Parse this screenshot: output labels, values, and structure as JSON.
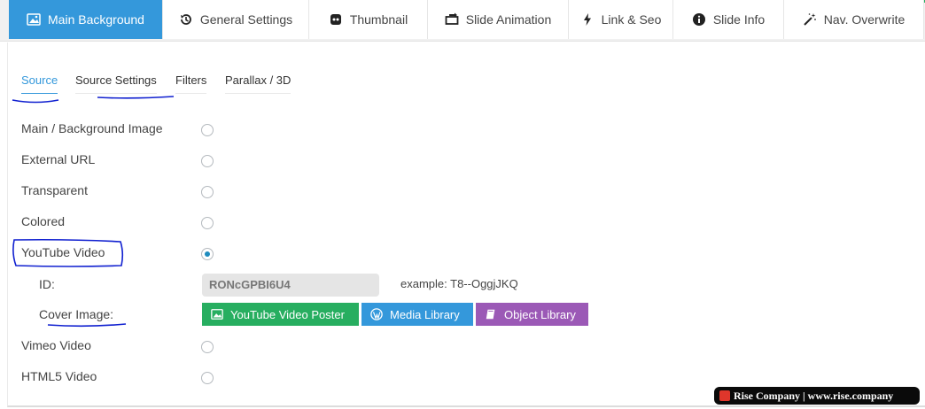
{
  "top_tabs": [
    {
      "label": "Main Background",
      "icon": "image-icon",
      "active": true
    },
    {
      "label": "General Settings",
      "icon": "history-icon"
    },
    {
      "label": "Thumbnail",
      "icon": "thumbnail-icon"
    },
    {
      "label": "Slide Animation",
      "icon": "animation-icon"
    },
    {
      "label": "Link & Seo",
      "icon": "bolt-icon"
    },
    {
      "label": "Slide Info",
      "icon": "info-icon"
    },
    {
      "label": "Nav. Overwrite",
      "icon": "magic-wand-icon"
    }
  ],
  "sub_tabs": [
    {
      "label": "Source",
      "active": true
    },
    {
      "label": "Source Settings"
    },
    {
      "label": "Filters"
    },
    {
      "label": "Parallax / 3D"
    }
  ],
  "source_options": [
    {
      "label": "Main / Background Image",
      "checked": false
    },
    {
      "label": "External URL",
      "checked": false
    },
    {
      "label": "Transparent",
      "checked": false
    },
    {
      "label": "Colored",
      "checked": false
    },
    {
      "label": "YouTube Video",
      "checked": true
    },
    {
      "label": "Vimeo Video",
      "checked": false
    },
    {
      "label": "HTML5 Video",
      "checked": false
    }
  ],
  "youtube": {
    "id_label": "ID:",
    "id_value": "RONcGPBI6U4",
    "example": "example: T8--OggjJKQ",
    "cover_label": "Cover Image:",
    "buttons": [
      {
        "label": "YouTube Video Poster",
        "color": "#27ae60",
        "icon": "image-icon"
      },
      {
        "label": "Media Library",
        "color": "#3498db",
        "icon": "wordpress-icon"
      },
      {
        "label": "Object Library",
        "color": "#9b59b6",
        "icon": "book-icon"
      }
    ]
  },
  "watermark": {
    "text": "Rise Company | www.rise.company"
  },
  "colors": {
    "accent": "#3498db",
    "annotation_ink": "#1020d0"
  }
}
